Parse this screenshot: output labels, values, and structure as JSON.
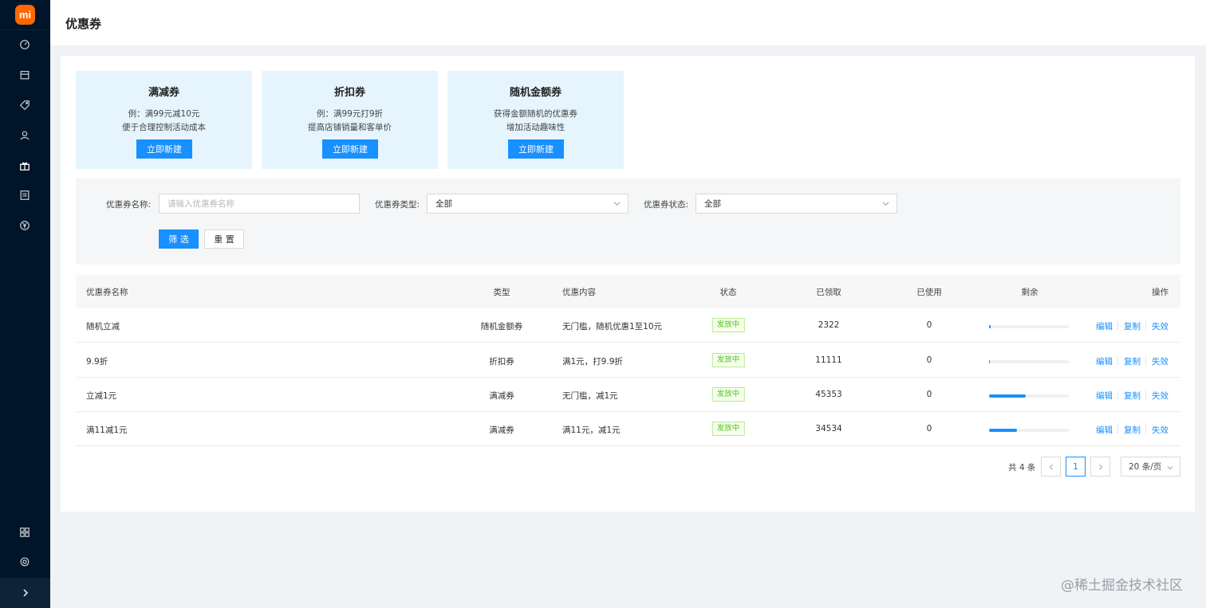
{
  "header": {
    "title": "优惠券"
  },
  "sidebar": {
    "logo": "mi",
    "icons": [
      "dashboard-icon",
      "store-icon",
      "tag-icon",
      "user-icon",
      "gift-icon",
      "list-icon",
      "yen-icon"
    ],
    "bottom_icons": [
      "widgets-icon",
      "settings-icon"
    ],
    "collapse_icon": "chevron-right-icon"
  },
  "coupon_types": [
    {
      "title": "满减券",
      "desc1": "例：满99元减10元",
      "desc2": "便于合理控制活动成本",
      "button": "立即新建"
    },
    {
      "title": "折扣券",
      "desc1": "例：满99元打9折",
      "desc2": "提高店铺销量和客单价",
      "button": "立即新建"
    },
    {
      "title": "随机金额券",
      "desc1": "获得金额随机的优惠券",
      "desc2": "增加活动趣味性",
      "button": "立即新建"
    }
  ],
  "filter": {
    "name_label": "优惠券名称:",
    "name_placeholder": "请输入优惠券名称",
    "type_label": "优惠券类型:",
    "type_value": "全部",
    "status_label": "优惠券状态:",
    "status_value": "全部",
    "filter_button": "筛 选",
    "reset_button": "重 置"
  },
  "table": {
    "columns": [
      "优惠券名称",
      "类型",
      "优惠内容",
      "状态",
      "已领取",
      "已使用",
      "剩余",
      "操作"
    ],
    "rows": [
      {
        "name": "随机立减",
        "type": "随机金额券",
        "content": "无门槛，随机优惠1至10元",
        "status": "发放中",
        "claimed": "2322",
        "used": "0",
        "remaining": 0.02
      },
      {
        "name": "9.9折",
        "type": "折扣券",
        "content": "满1元，打9.9折",
        "status": "发放中",
        "claimed": "11111",
        "used": "0",
        "remaining": 0.01
      },
      {
        "name": "立减1元",
        "type": "满减券",
        "content": "无门槛，减1元",
        "status": "发放中",
        "claimed": "45353",
        "used": "0",
        "remaining": 0.46
      },
      {
        "name": "满11减1元",
        "type": "满减券",
        "content": "满11元，减1元",
        "status": "发放中",
        "claimed": "34534",
        "used": "0",
        "remaining": 0.35
      }
    ],
    "actions": {
      "edit": "编辑",
      "copy": "复制",
      "invalidate": "失效"
    }
  },
  "pagination": {
    "total": "共 4 条",
    "current": "1",
    "page_size": "20 条/页"
  },
  "watermark": "@稀土掘金技术社区",
  "colors": {
    "primary": "#1890ff",
    "sidebar": "#001529",
    "card_bg": "#e6f5fd",
    "status_green": "#52c41a"
  }
}
